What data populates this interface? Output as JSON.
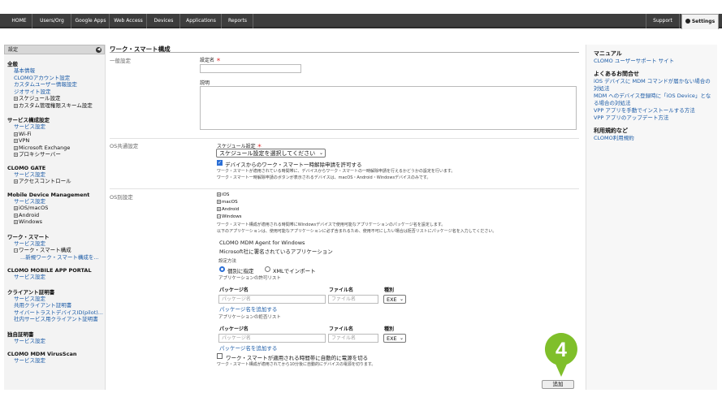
{
  "topnav": {
    "items": [
      "HOME",
      "Users/Org",
      "Google Apps",
      "Web Access",
      "Devices",
      "Applications",
      "Reports"
    ],
    "support": "Support",
    "settings": "Settings"
  },
  "sidebar": {
    "header": "設定",
    "collapse_icon": "◀",
    "groups": [
      {
        "title": "全般",
        "links": [
          "基本情報",
          "CLOMOアカウント設定",
          "カスタムユーザー情報設定",
          "ジオサイト設定"
        ],
        "tree": [
          "スケジュール設定",
          "カスタム管理権限スキーム設定"
        ]
      },
      {
        "title": "サービス構成設定",
        "links": [
          "サービス設定"
        ],
        "tree": [
          "Wi-Fi",
          "VPN",
          "Microsoft Exchange",
          "プロキシサーバー"
        ]
      },
      {
        "title": "CLOMO GATE",
        "links": [
          "サービス設定"
        ],
        "tree": [
          "アクセスコントロール"
        ]
      },
      {
        "title": "Mobile Device Management",
        "links": [
          "サービス設定"
        ],
        "tree": [
          "iOS/macOS",
          "Android",
          "Windows"
        ]
      },
      {
        "title": "ワーク・スマート",
        "links": [
          "サービス設定"
        ],
        "tree": [
          "ワーク・スマート構成"
        ],
        "sublinks": [
          "...新規ワーク・スマート構成を..."
        ]
      },
      {
        "title": "CLOMO MOBILE APP PORTAL",
        "links": [
          "サービス設定"
        ],
        "tree": []
      },
      {
        "title": "クライアント証明書",
        "links": [
          "サービス設定",
          "共用クライアント証明書",
          "サイバートラストデバイスID(pilot)...",
          "社内サービス用クライアント証明書"
        ],
        "tree": []
      },
      {
        "title": "独自証明書",
        "links": [
          "サービス設定"
        ],
        "tree": []
      },
      {
        "title": "CLOMO MDM VirusScan",
        "links": [
          "サービス設定"
        ],
        "tree": []
      }
    ]
  },
  "main": {
    "title": "ワーク・スマート構成",
    "general": {
      "section": "一般設定",
      "name_label": "設定名",
      "required_mark": "＊",
      "desc_label": "説明"
    },
    "os_common": {
      "section": "OS共通設定",
      "schedule_label": "スケジュール設定",
      "schedule_value": "スケジュール設定を選択してください",
      "allow_label": "デバイスからのワーク・スマート一時解除申請を許可する",
      "allow_help1": "ワーク・スマートが適用されている時間帯に、デバイスからワーク・スマートの一時解除申請を行えるかどうかの設定を行います。",
      "allow_help2": "ワーク・スマート一時解除申請のボタンが表示されるデバイスは、macOS・Android・Windowsデバイスのみです。"
    },
    "os_specific": {
      "section": "OS別設定",
      "os_items": [
        "iOS",
        "macOS",
        "Android",
        "Windows"
      ],
      "help1": "ワーク・スマート構成が適用される時間帯にWindowsデバイスで使用可能なアプリケーションのパッケージ名を設定します。",
      "help2": "以下のアプリケーションは、使用可能なアプリケーションに必ず含まれるため、使用不可にしたい場合は拒否リストにパッケージ名を入力してください。",
      "agent_name": "CLOMO MDM Agent for Windows",
      "agent_signed": "Microsoft社に署名されているアプリケーション",
      "method_label": "設定方法",
      "method_individual": "個別に指定",
      "method_xml": "XMLでインポート",
      "allow_list_label": "アプリケーションの許可リスト",
      "deny_list_label": "アプリケーションの拒否リスト",
      "col_package": "パッケージ名",
      "col_file": "ファイル名",
      "col_type": "種別",
      "ph_package": "パッケージ名",
      "ph_file": "ファイル名",
      "type_value": "EXE",
      "add_package": "パッケージ名を追加する",
      "power_label": "ワーク・スマートが適用される時間帯に自動的に電源を切る",
      "power_help": "ワーク・スマート構成が適用されてから10分後に自動的にデバイスの電源を切ります。"
    },
    "add_button": "追加",
    "callout_number": "4"
  },
  "right": {
    "manual_title": "マニュアル",
    "manual_link": "CLOMO ユーザーサポート サイト",
    "faq_title": "よくあるお問合せ",
    "faq_links": [
      "iOS デバイスに MDM コマンドが届かない場合の対処法",
      "MDM へのデバイス登録時に「iOS Device」となる場合の対処法",
      "VPP アプリを手動でインストールする方法",
      "VPP アプリのアップデート方法"
    ],
    "terms_title": "利用規約など",
    "terms_link": "CLOMO利用規約"
  },
  "colors": {
    "accent": "#7fbf2a",
    "link": "#1a5aa6",
    "nav": "#3d3d3d"
  }
}
